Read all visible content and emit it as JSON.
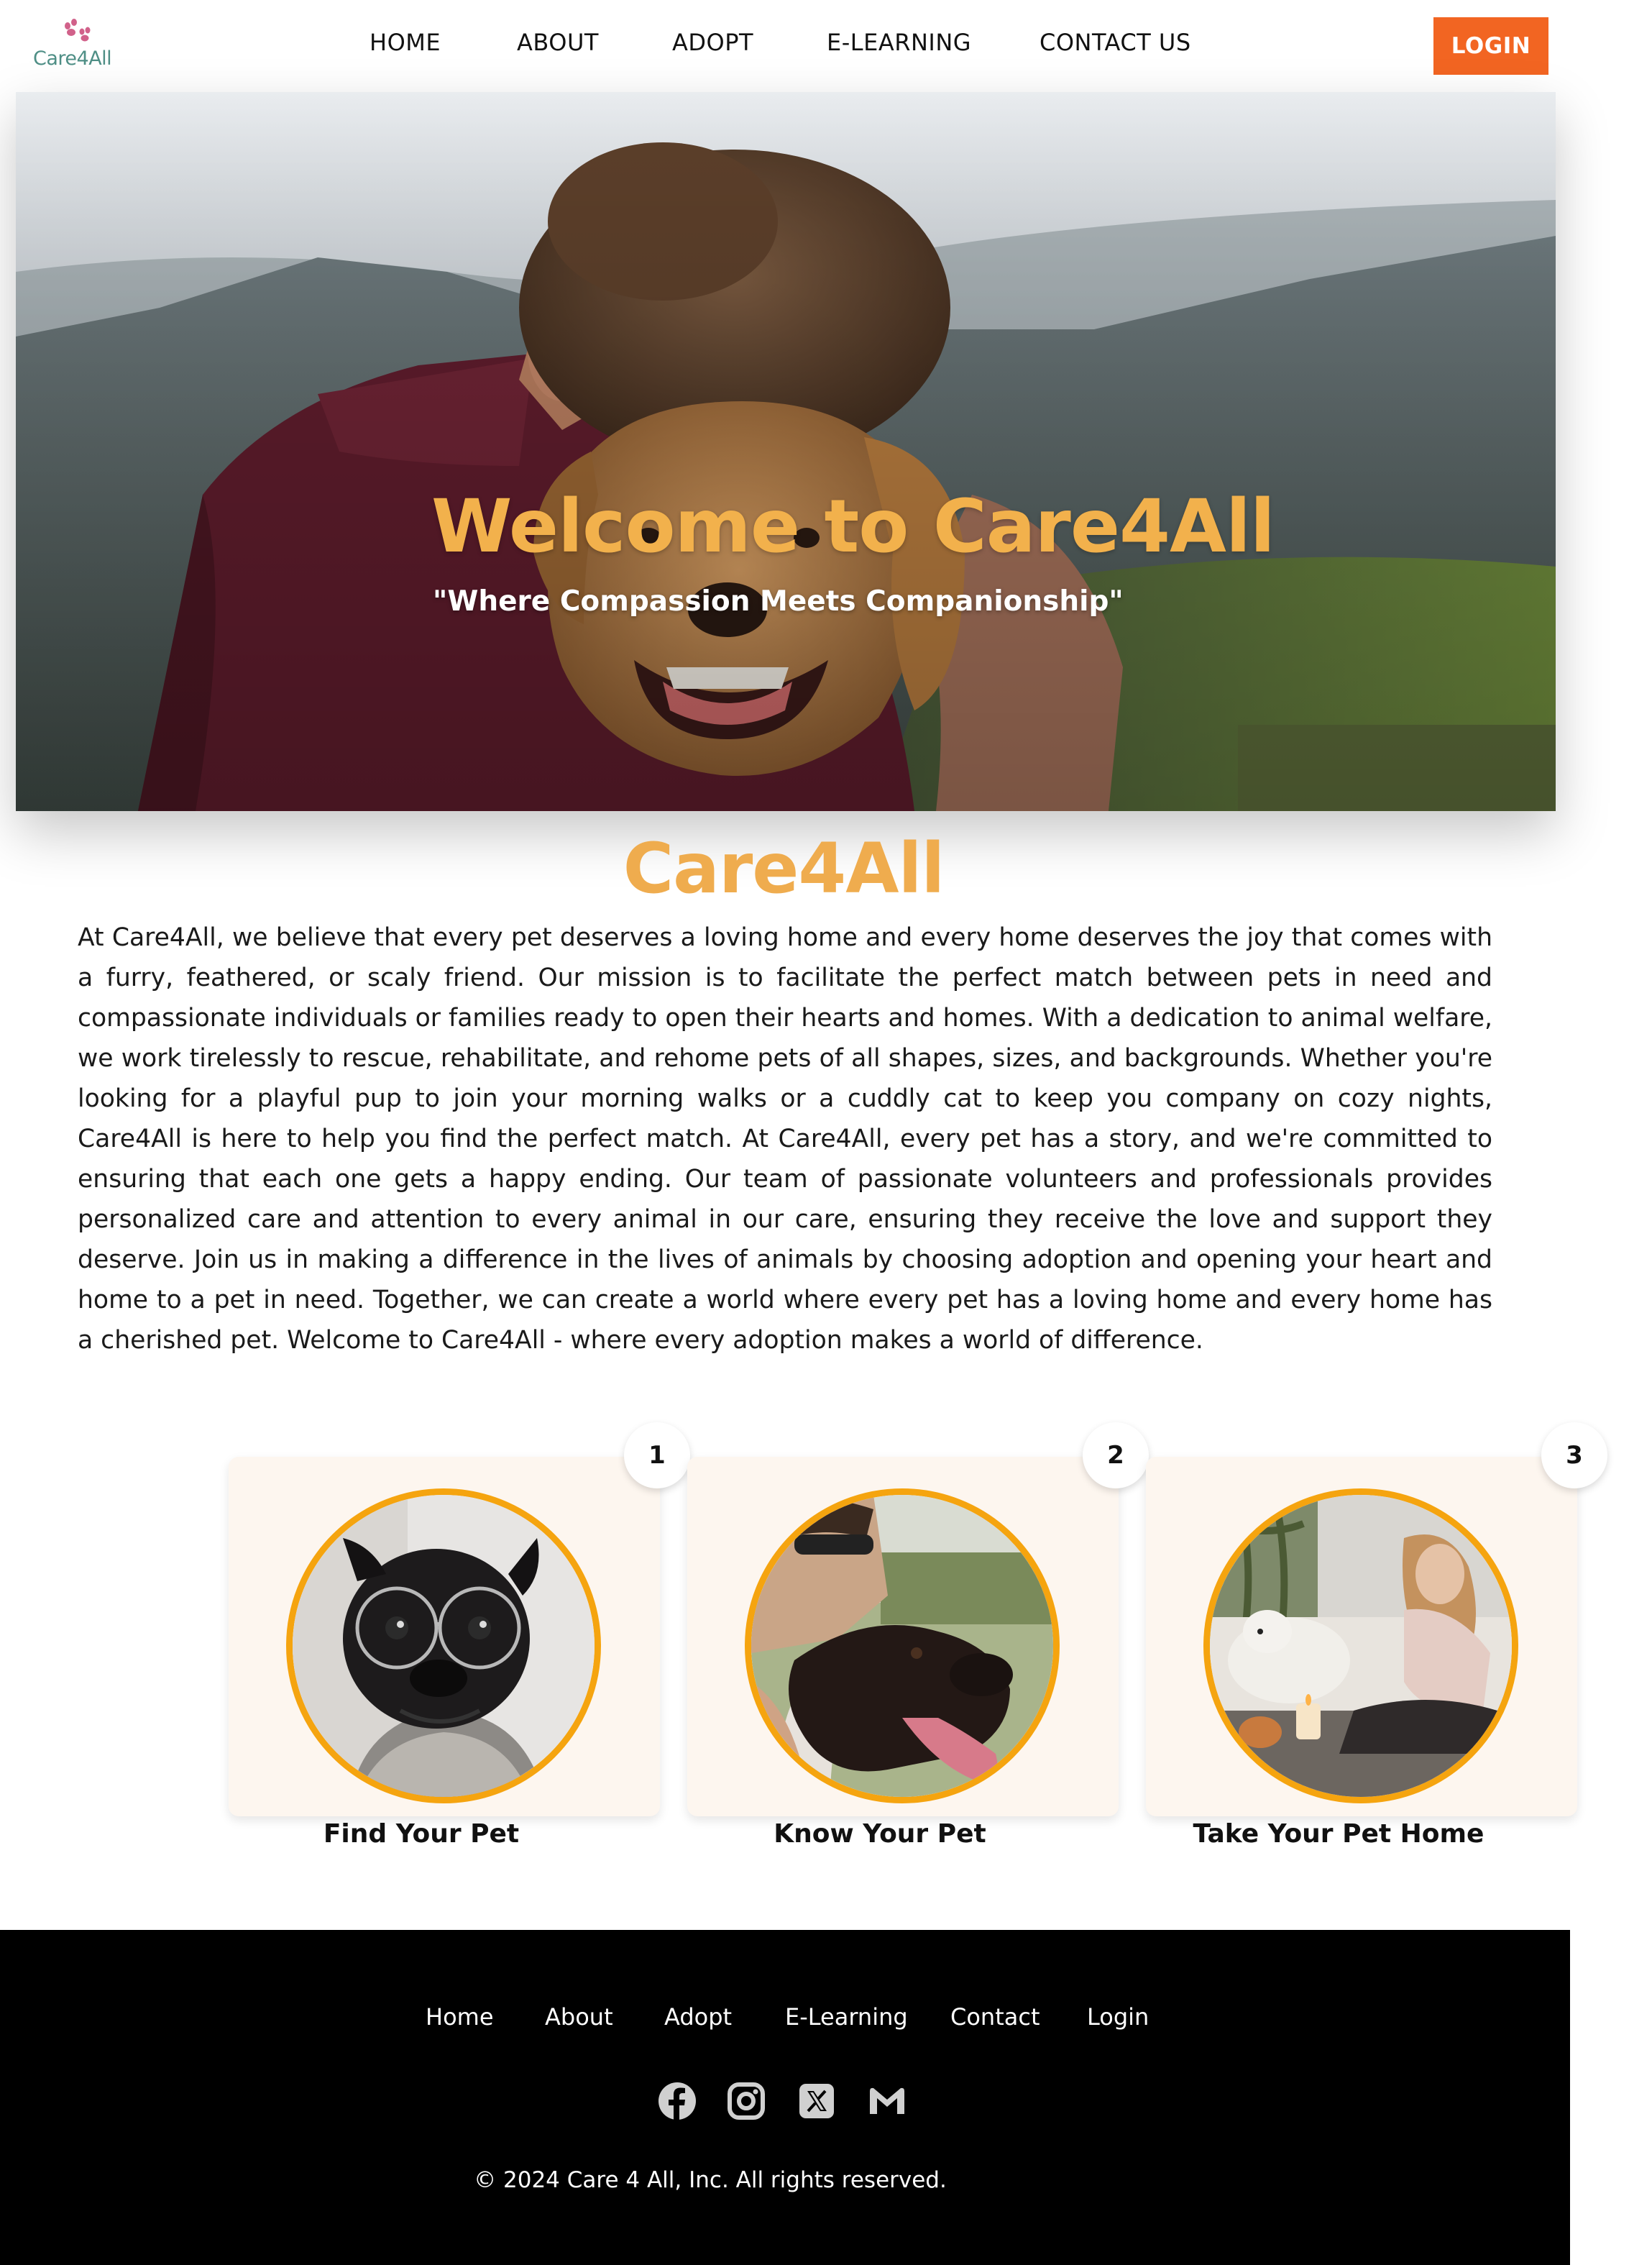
{
  "header": {
    "logo_text": "Care4All",
    "nav": [
      "HOME",
      "ABOUT",
      "ADOPT",
      "E-LEARNING",
      "CONTACT US"
    ],
    "login_label": "LOGIN"
  },
  "hero": {
    "title": "Welcome to Care4All",
    "subtitle": "\"Where Compassion Meets Companionship\""
  },
  "about": {
    "title": "Care4All",
    "text": "At Care4All, we believe that every pet deserves a loving home and every home deserves the joy that comes with a furry, feathered, or scaly friend. Our mission is to facilitate the perfect match between pets in need and compassionate individuals or families ready to open their hearts and homes. With a dedication to animal welfare, we work tirelessly to rescue, rehabilitate, and rehome pets of all shapes, sizes, and backgrounds. Whether you're looking for a playful pup to join your morning walks or a cuddly cat to keep you company on cozy nights, Care4All is here to help you find the perfect match. At Care4All, every pet has a story, and we're committed to ensuring that each one gets a happy ending. Our team of passionate volunteers and professionals provides personalized care and attention to every animal in our care, ensuring they receive the love and support they deserve. Join us in making a difference in the lives of animals by choosing adoption and opening your heart and home to a pet in need. Together, we can create a world where every pet has a loving home and every home has a cherished pet. Welcome to Care4All - where every adoption makes a world of difference."
  },
  "steps": [
    {
      "number": "1",
      "label": "Find Your Pet"
    },
    {
      "number": "2",
      "label": "Know Your Pet"
    },
    {
      "number": "3",
      "label": "Take Your Pet Home"
    }
  ],
  "footer": {
    "links": [
      "Home",
      "About",
      "Adopt",
      "E-Learning",
      "Contact",
      "Login"
    ],
    "social_icons": [
      "facebook-icon",
      "instagram-icon",
      "x-twitter-icon",
      "gmail-icon"
    ],
    "copyright": "© 2024 Care 4 All, Inc. All rights reserved."
  },
  "colors": {
    "accent_orange": "#f26522",
    "title_gold": "#efac4e",
    "circle_border": "#f5a40f",
    "card_bg": "#fdf6ef",
    "footer_bg": "#000000"
  }
}
